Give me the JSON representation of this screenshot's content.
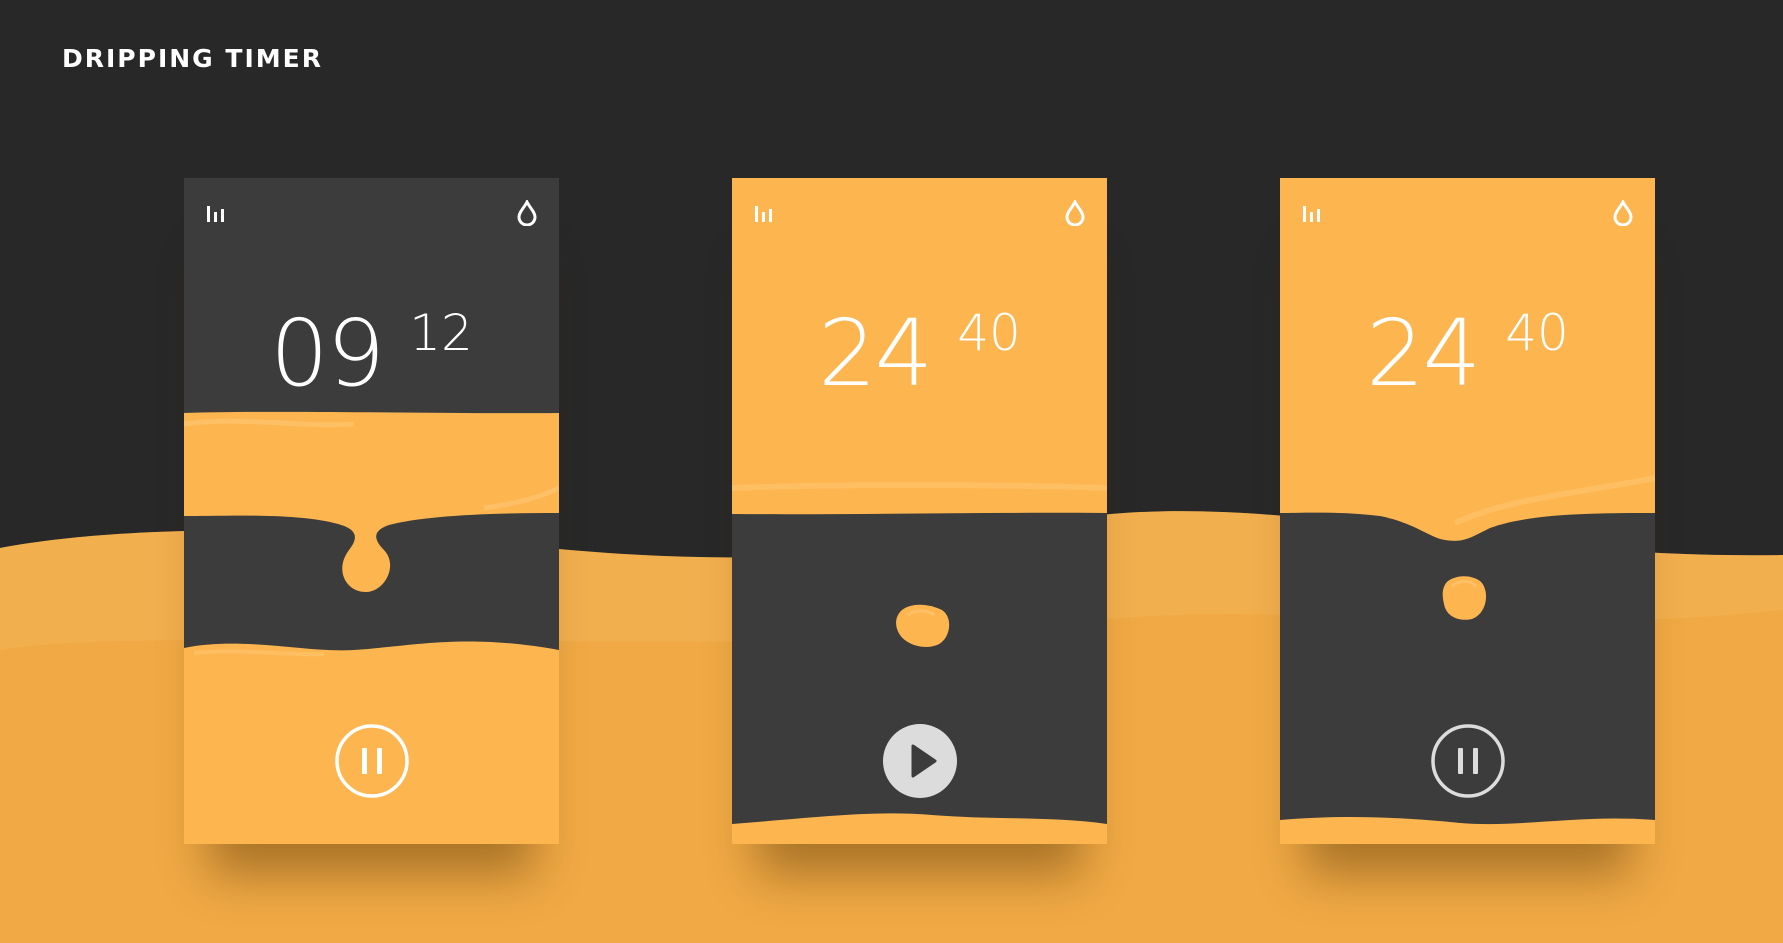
{
  "app": {
    "title": "DRIPPING TIMER"
  },
  "colors": {
    "accent": "#FDB54F",
    "accent_dark": "#F0A944",
    "panel": "#3C3C3C",
    "background": "#282828",
    "button": "#DCDCDC"
  },
  "screens": [
    {
      "state": "running",
      "minutes": "09",
      "seconds": "12",
      "left_icon": "stats-bars-icon",
      "right_icon": "water-drop-icon",
      "control": "pause-icon"
    },
    {
      "state": "paused",
      "minutes": "24",
      "seconds": "40",
      "left_icon": "stats-bars-icon",
      "right_icon": "water-drop-icon",
      "control": "play-icon"
    },
    {
      "state": "running",
      "minutes": "24",
      "seconds": "40",
      "left_icon": "stats-bars-icon",
      "right_icon": "water-drop-icon",
      "control": "pause-icon"
    }
  ]
}
